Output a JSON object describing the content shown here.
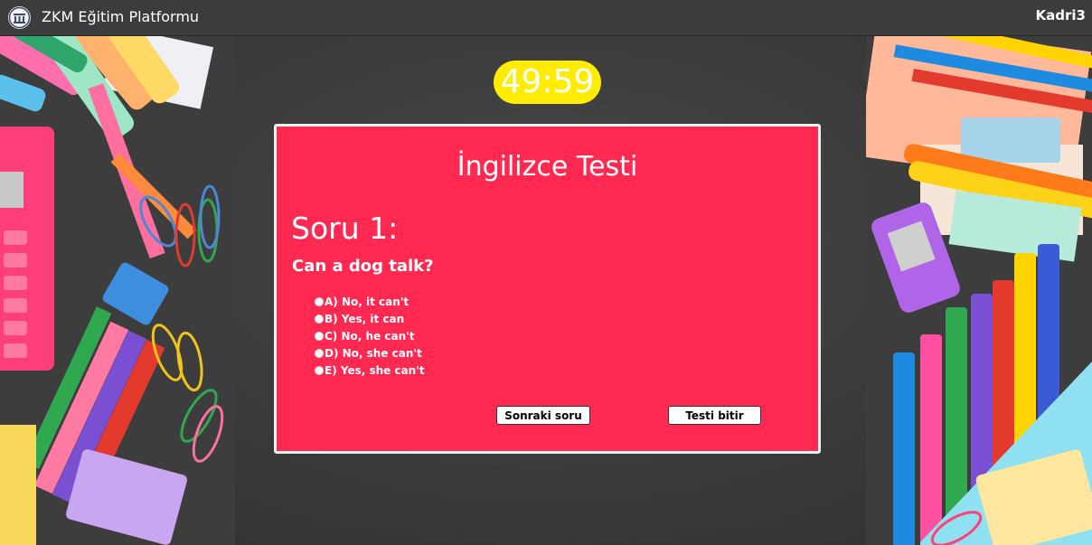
{
  "header": {
    "brand": "ZKM Eğitim Platformu",
    "user": "Kadri3"
  },
  "timer": {
    "value": "49:59"
  },
  "quiz": {
    "title": "İngilizce Testi",
    "question_number": "Soru 1:",
    "question_text": "Can a dog talk?",
    "options": [
      "A) No, it can't",
      "B) Yes, it can",
      "C) No, he can't",
      "D) No, she can't",
      "E) Yes, she can't"
    ],
    "next_label": "Sonraki soru",
    "finish_label": "Testi bitir"
  },
  "colors": {
    "card": "#ff2952",
    "timer": "#ffec00",
    "topbar": "#3c3c3c"
  }
}
